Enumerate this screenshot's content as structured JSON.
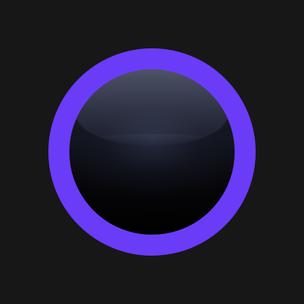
{
  "colors": {
    "background": "#171717",
    "ring": "#6a3cf7",
    "button_face": "#0b0c12"
  },
  "button": {
    "icon": "round-glossy-button"
  }
}
